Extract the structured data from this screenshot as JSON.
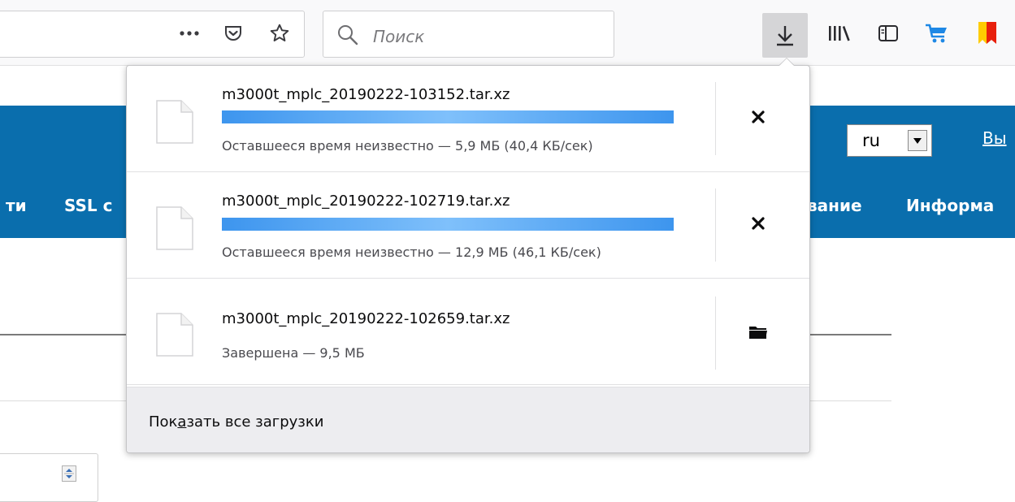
{
  "toolbar": {
    "search_placeholder": "Поиск"
  },
  "page": {
    "lang_value": "ru",
    "link_partial": "Вы",
    "nav_items": [
      "ти",
      "SSL с",
      "вание",
      "Информа"
    ]
  },
  "downloads": {
    "items": [
      {
        "filename": "m3000t_mplc_20190222-103152.tar.xz",
        "status": "Оставшееся время неизвестно — 5,9 МБ (40,4 КБ/сек)",
        "progress": null,
        "action": "cancel"
      },
      {
        "filename": "m3000t_mplc_20190222-102719.tar.xz",
        "status": "Оставшееся время неизвестно — 12,9 МБ (46,1 КБ/сек)",
        "progress": null,
        "action": "cancel"
      },
      {
        "filename": "m3000t_mplc_20190222-102659.tar.xz",
        "status": "Завершена — 9,5 МБ",
        "progress": 1.0,
        "action": "open-folder"
      }
    ],
    "footer": {
      "pre": "Пок",
      "accel": "а",
      "post": "зать все загрузки"
    }
  },
  "colors": {
    "accent_blue": "#0a6ead",
    "progress_blue": "#3d95ee"
  }
}
